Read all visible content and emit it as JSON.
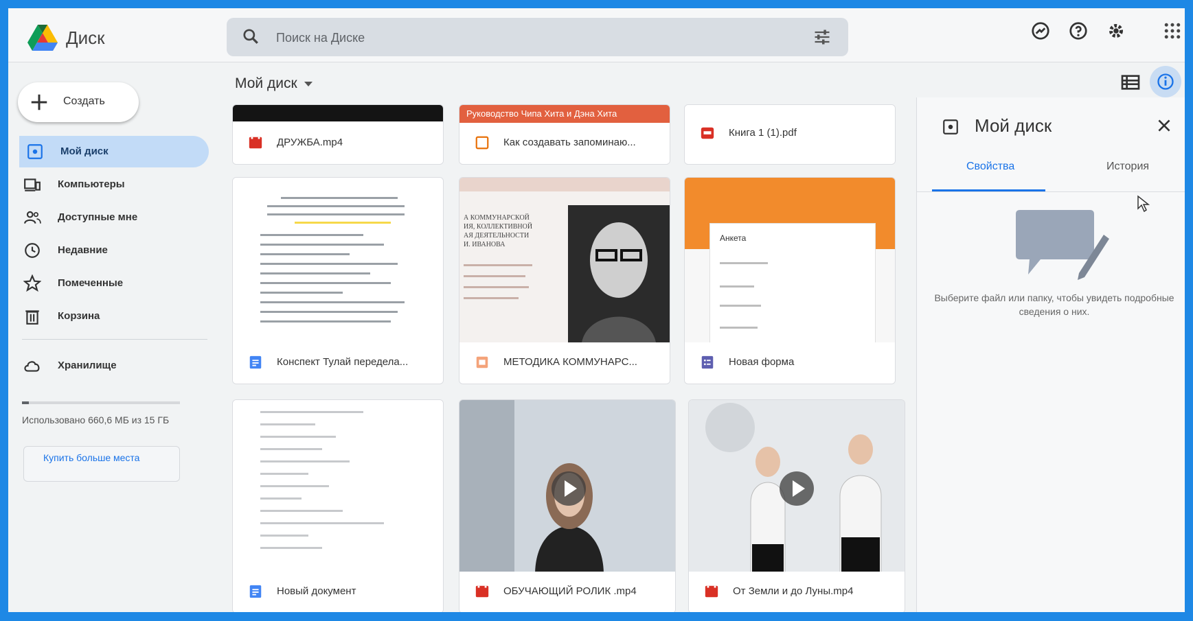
{
  "app": {
    "title": "Диск"
  },
  "search": {
    "placeholder": "Поиск на Диске"
  },
  "sidebar": {
    "create_label": "Создать",
    "items": [
      {
        "label": "Мой диск",
        "icon": "my-drive-icon",
        "active": true
      },
      {
        "label": "Компьютеры",
        "icon": "computer-icon"
      },
      {
        "label": "Доступные мне",
        "icon": "shared-people-icon"
      },
      {
        "label": "Недавние",
        "icon": "clock-icon"
      },
      {
        "label": "Помеченные",
        "icon": "star-icon"
      },
      {
        "label": "Корзина",
        "icon": "trash-icon"
      }
    ],
    "storage": {
      "label": "Хранилище",
      "used_text": "Использовано 660,6 МБ из 15 ГБ",
      "used_fraction": 0.043,
      "buy_label": "Купить больше места"
    }
  },
  "main": {
    "title": "Мой диск",
    "files": [
      {
        "name": "ДРУЖБА.mp4",
        "type": "video"
      },
      {
        "name": "Как создавать запоминаю...",
        "type": "slides",
        "thumb_text": "Руководство Чипа Хита и Дэна Хита"
      },
      {
        "name": "Книга 1 (1).pdf",
        "type": "pdf"
      },
      {
        "name": "Конспект Тулай передела...",
        "type": "doc"
      },
      {
        "name": "МЕТОДИКА КОММУНАРС...",
        "type": "slides",
        "thumb_text": "А КОММУНАРСКОЙ\nИЯ, КОЛЛЕКТИВНОЙ\nАЯ ДЕЯТЕЛЬНОСТИ\nИ. ИВАНОВА"
      },
      {
        "name": "Новая форма",
        "type": "form",
        "thumb_text": "Анкета"
      },
      {
        "name": "Новый документ",
        "type": "doc"
      },
      {
        "name": "ОБУЧАЮЩИЙ РОЛИК .mp4",
        "type": "video"
      },
      {
        "name": "От Земли и до Луны.mp4",
        "type": "video"
      }
    ]
  },
  "panel": {
    "title": "Мой диск",
    "tabs": [
      {
        "label": "Свойства",
        "active": true
      },
      {
        "label": "История"
      }
    ],
    "empty_message": "Выберите файл или папку, чтобы увидеть подробные сведения о них."
  },
  "colors": {
    "accent": "#1a73e8",
    "active_nav": "#c2dbf7",
    "video_red": "#d93025",
    "slides_orange": "#f9ab00",
    "frame": "#1e88e5"
  }
}
